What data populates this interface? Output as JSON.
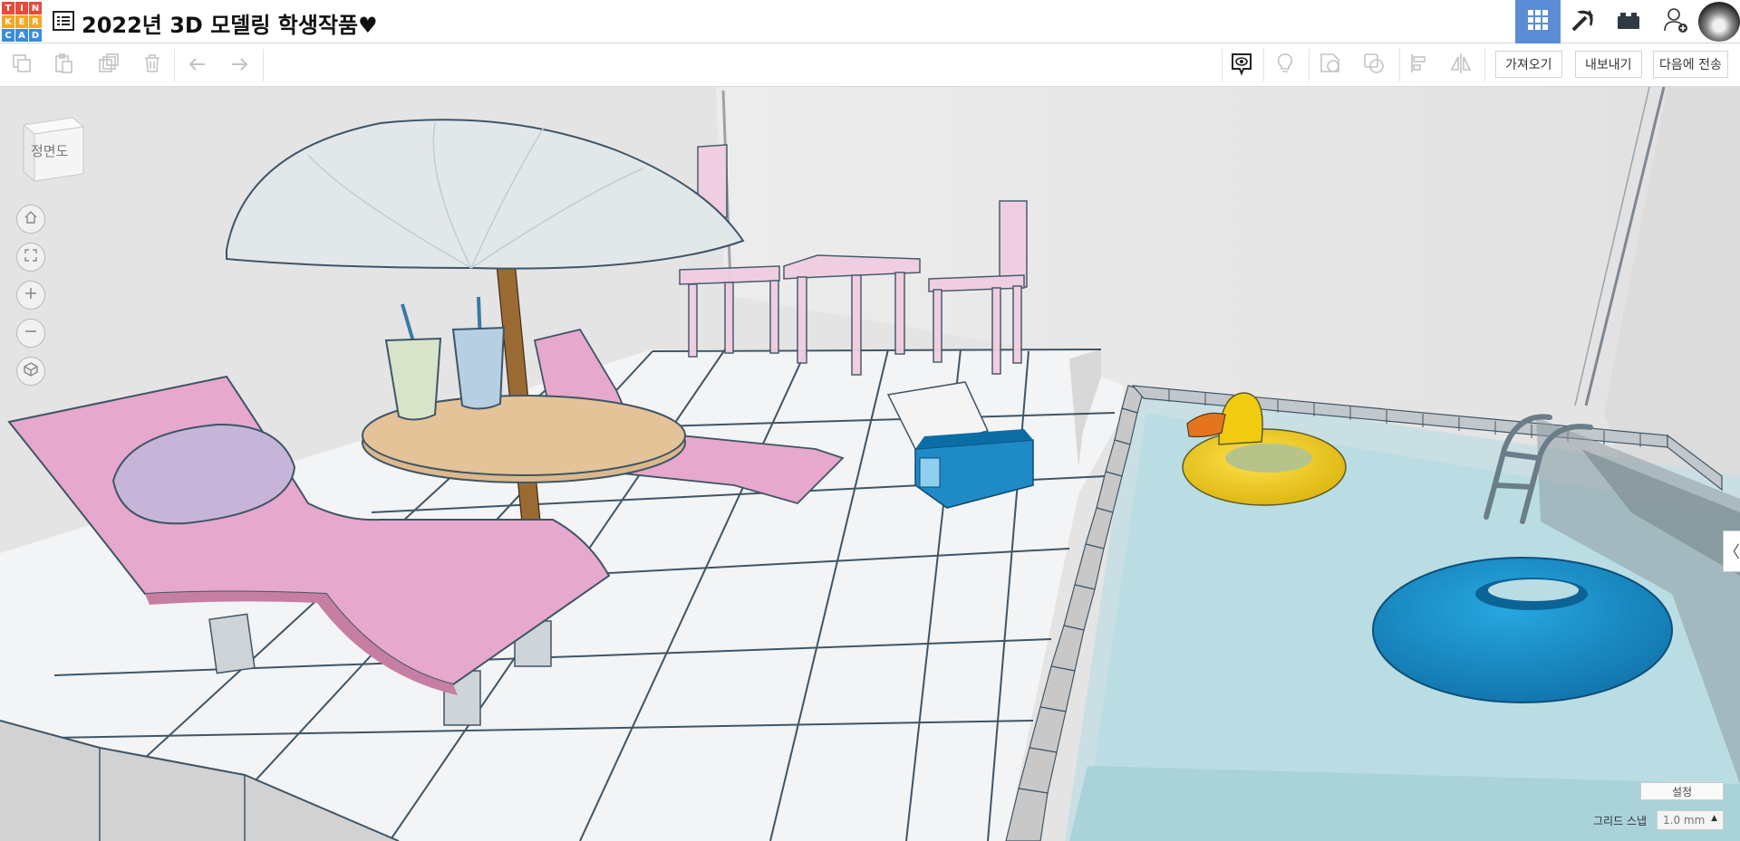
{
  "header": {
    "logo_letters": [
      "T",
      "I",
      "N",
      "K",
      "E",
      "R",
      "C",
      "A",
      "D"
    ],
    "logo_colors": [
      "#e8493b",
      "#e8493b",
      "#e8493b",
      "#f5a623",
      "#f5a623",
      "#f5a623",
      "#3a8ddb",
      "#3a8ddb",
      "#3a8ddb"
    ],
    "title": "2022년 3D 모델링 학생작품♥",
    "active_color": "#5b8dd6",
    "buttons": [
      "grid-view-icon",
      "pickaxe-icon",
      "bricks-icon",
      "add-user-icon"
    ]
  },
  "toolbar": {
    "tools": [
      "copy-icon",
      "paste-icon",
      "duplicate-icon",
      "delete-icon",
      "undo-icon",
      "redo-icon"
    ],
    "right_tools": [
      "notes-toggle-icon",
      "light-bulb-icon",
      "shape-icon",
      "group-icon",
      "align-icon",
      "mirror-icon"
    ],
    "import_label": "가져오기",
    "export_label": "내보내기",
    "send_label": "다음에 전송"
  },
  "viewport": {
    "viewcube_label": "정면도",
    "nav": [
      "home-view-icon",
      "fit-all-icon",
      "zoom-in-icon",
      "zoom-out-icon",
      "perspective-icon"
    ],
    "side_tab": "〈",
    "settings_label": "설정",
    "snap_label": "그리드 스냅",
    "snap_value": "1.0 mm",
    "colors": {
      "chair": "#e6a8cc",
      "pillow": "#c7b5d9",
      "umbrella": "#e2e7ea",
      "table": "#dbb98b",
      "pole": "#9a6a33",
      "cooler": "#1e8ac6",
      "water": "#b9dde3",
      "duck_ring": "#f3d11a",
      "beak": "#e5741f",
      "tube": "#1a93cc",
      "furniture": "#f1cde1"
    }
  }
}
